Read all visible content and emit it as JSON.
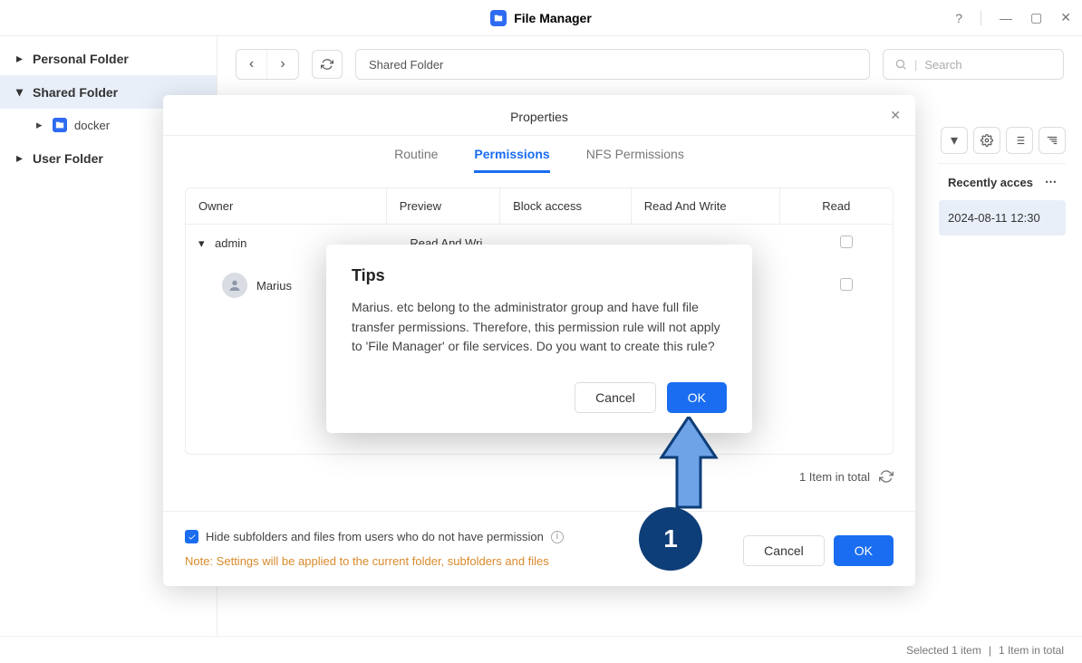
{
  "titlebar": {
    "app_name": "File Manager"
  },
  "sidebar": {
    "items": [
      {
        "label": "Personal Folder"
      },
      {
        "label": "Shared Folder"
      },
      {
        "label": "User Folder"
      }
    ],
    "sub_docker": "docker"
  },
  "toolbar": {
    "path": "Shared Folder",
    "search_placeholder": "Search"
  },
  "view": {
    "recent_head": "Recently acces",
    "recent_date": "2024-08-11 12:30"
  },
  "status": {
    "selected": "Selected 1 item",
    "total": "1 Item in total"
  },
  "props": {
    "title": "Properties",
    "tabs": {
      "routine": "Routine",
      "permissions": "Permissions",
      "nfs": "NFS Permissions"
    },
    "cols": {
      "owner": "Owner",
      "preview": "Preview",
      "block": "Block access",
      "rw": "Read And Write",
      "read": "Read"
    },
    "rows": {
      "admin": "admin",
      "marius": "Marius",
      "rw_label": "Read And Wri"
    },
    "footer_total": "1 Item in total",
    "hide_label": "Hide subfolders and files from users who do not have permission",
    "note": "Note: Settings will be applied to the current folder, subfolders and files",
    "cancel": "Cancel",
    "ok": "OK"
  },
  "tips": {
    "title": "Tips",
    "body": "Marius. etc belong to the administrator group and have full file transfer permissions. Therefore, this permission rule will not apply to 'File Manager' or file services. Do you want to create this rule?",
    "cancel": "Cancel",
    "ok": "OK"
  },
  "anno": {
    "step": "1"
  }
}
